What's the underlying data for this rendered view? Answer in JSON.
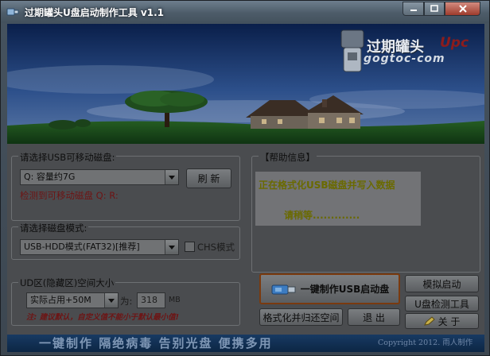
{
  "window": {
    "title": "过期罐头U盘启动制作工具 v1.1"
  },
  "banner": {
    "logo_cn": "过期罐头",
    "logo_badge": "Upc",
    "logo_url": "gogtoc-com"
  },
  "usb_section": {
    "label": "请选择USB可移动磁盘:",
    "selected_drive": "Q:    容量约7G",
    "refresh_label": "刷 新",
    "detected_text": "检测到可移动磁盘  Q: R:"
  },
  "mode_section": {
    "label": "请选择磁盘模式:",
    "selected_mode": "USB-HDD模式(FAT32)[推荐]",
    "chs_label": "CHS模式"
  },
  "ud_section": {
    "label": "UD区(隐藏区)空间大小",
    "selected_size": "实际占用+50M",
    "size_prefix": "为:",
    "size_value": "318",
    "size_unit": "MB",
    "note": "注: 建议默认，自定义值不能小于默认最小值!"
  },
  "help": {
    "label": "【帮助信息】",
    "line1": "正在格式化USB磁盘并写入数据",
    "line2": "请稍等............."
  },
  "actions": {
    "make_label": "一键制作USB启动盘",
    "simulate_label": "模拟启动",
    "check_label": "U盘检测工具",
    "about_label": "关 于",
    "restore_label": "格式化并归还空间",
    "exit_label": "退 出"
  },
  "status": {
    "slogan": "一键制作  隔绝病毒  告别光盘  便携多用",
    "copyright": "Copyright 2012. 雨人制作"
  },
  "colors": {
    "title_text": "#ffffff",
    "help_text": "#6a6a00",
    "warning_red": "#6e1414",
    "status_bg": "#0c2644"
  },
  "icons": [
    "app-icon",
    "usb-stick-icon",
    "chevron-down-icon",
    "about-pencil-icon",
    "checkbox-icon"
  ]
}
